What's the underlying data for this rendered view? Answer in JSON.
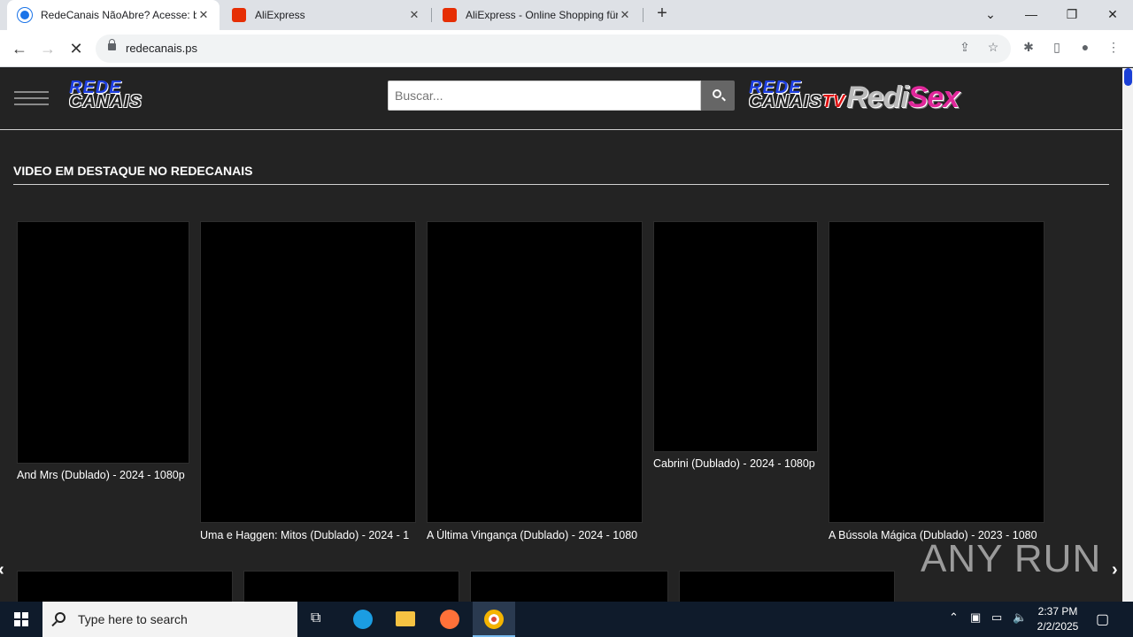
{
  "browser": {
    "tabs": [
      {
        "title": "RedeCanais NãoAbre? Acesse: b",
        "active": true
      },
      {
        "title": "AliExpress",
        "active": false
      },
      {
        "title": "AliExpress - Online Shopping für",
        "active": false
      }
    ],
    "url": "redecanais.ps"
  },
  "site": {
    "logo": {
      "line1": "REDE",
      "line2": "CANAIS"
    },
    "logo_tv": {
      "line1": "REDE",
      "line2": "CANAIS",
      "tv": "TV"
    },
    "logo_sex": {
      "part1": "Redi",
      "part2": "Sex"
    },
    "search_placeholder": "Buscar...",
    "section_title": "VIDEO EM DESTAQUE NO REDECANAIS",
    "videos": [
      {
        "caption": "And Mrs (Dublado) - 2024 - 1080p"
      },
      {
        "caption": "Uma e Haggen: Mitos (Dublado) - 2024 - 1"
      },
      {
        "caption": "A Última Vingança (Dublado) - 2024 - 1080"
      },
      {
        "caption": "Cabrini (Dublado) - 2024 - 1080p"
      },
      {
        "caption": "A Bússola Mágica (Dublado) - 2023 - 1080"
      }
    ],
    "watermark": "ANY RUN"
  },
  "taskbar": {
    "search_text": "Type here to search",
    "time": "2:37 PM",
    "date": "2/2/2025"
  }
}
